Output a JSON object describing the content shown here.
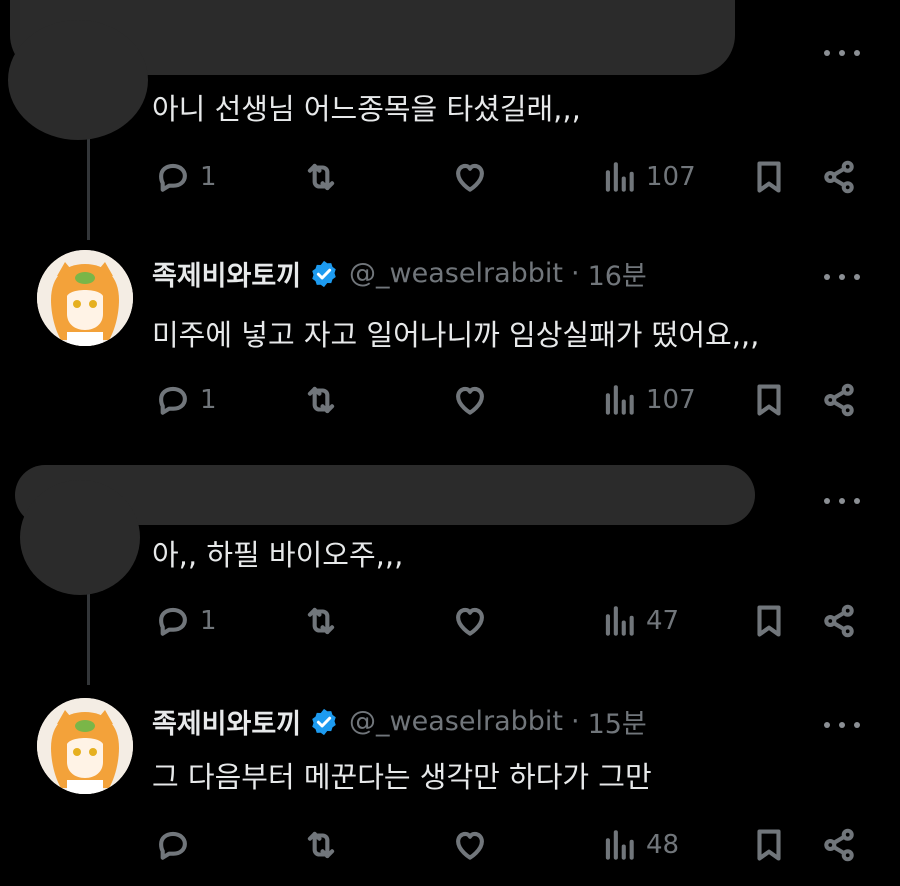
{
  "tweets": [
    {
      "redacted": true,
      "text": "아니 선생님 어느종목을 타셨길래,,,",
      "replies": "1",
      "views": "107"
    },
    {
      "redacted": false,
      "name": "족제비와토끼",
      "handle": "@_weaselrabbit",
      "dot": "·",
      "time": "16분",
      "text": "미주에 넣고 자고 일어나니까 임상실패가 떴어요,,,",
      "replies": "1",
      "views": "107"
    },
    {
      "redacted": true,
      "text": "아,, 하필 바이오주,,,",
      "replies": "1",
      "views": "47"
    },
    {
      "redacted": false,
      "name": "족제비와토끼",
      "handle": "@_weaselrabbit",
      "dot": "·",
      "time": "15분",
      "text": "그 다음부터 메꾼다는 생각만 하다가 그만",
      "replies": "",
      "views": "48"
    }
  ],
  "icons": {
    "reply": "reply-icon",
    "retweet": "retweet-icon",
    "like": "heart-icon",
    "views": "views-icon",
    "bookmark": "bookmark-icon",
    "share": "share-icon",
    "more": "more-icon",
    "verified": "verified-badge-icon"
  },
  "colors": {
    "background": "#000000",
    "text": "#e7e9ea",
    "muted": "#71767b",
    "verified": "#1d9bf0",
    "thread_line": "#333639"
  }
}
